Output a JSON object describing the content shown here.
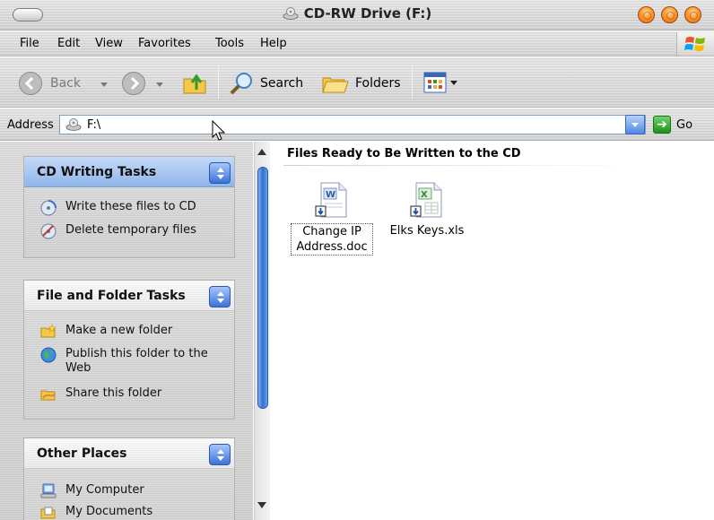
{
  "window": {
    "title": "CD-RW Drive (F:)"
  },
  "menu": [
    "File",
    "Edit",
    "View",
    "Favorites",
    "Tools",
    "Help"
  ],
  "toolbar": {
    "back_label": "Back",
    "search_label": "Search",
    "folders_label": "Folders"
  },
  "address": {
    "label": "Address",
    "value": "F:\\",
    "go_label": "Go"
  },
  "tasks": {
    "cd_writing": {
      "title": "CD Writing Tasks",
      "items": [
        "Write these files to CD",
        "Delete temporary files"
      ]
    },
    "file_folder": {
      "title": "File and Folder Tasks",
      "items": [
        "Make a new folder",
        "Publish this folder to the Web",
        "Share this folder"
      ]
    },
    "other_places": {
      "title": "Other Places",
      "items": [
        "My Computer",
        "My Documents"
      ]
    }
  },
  "content": {
    "group_header": "Files Ready to Be Written to the CD",
    "files": [
      {
        "name": "Change IP Address.doc",
        "icon": "word-document-icon",
        "selected": true
      },
      {
        "name": "Elks Keys.xls",
        "icon": "excel-document-icon",
        "selected": false
      }
    ]
  },
  "colors": {
    "accent_blue": "#3c72d6",
    "window_button_orange": "#ff9a2e"
  }
}
